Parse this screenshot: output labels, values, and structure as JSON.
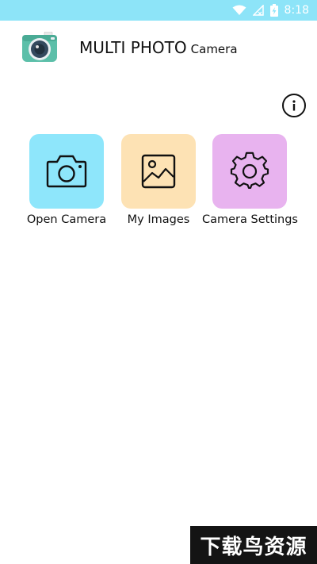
{
  "status_bar": {
    "time": "8:18",
    "background": "#8de4f8",
    "icons": [
      "wifi-icon",
      "no-signal-icon",
      "battery-charging-icon"
    ]
  },
  "header": {
    "title_main": "MULTI PHOTO",
    "title_sub": "Camera",
    "logo": "camera-logo-icon"
  },
  "info": {
    "icon": "info-icon"
  },
  "tiles": [
    {
      "label": "Open Camera",
      "icon": "camera-icon",
      "color": "#8ee6fb"
    },
    {
      "label": "My Images",
      "icon": "image-icon",
      "color": "#fde2b4"
    },
    {
      "label": "Camera Settings",
      "icon": "gear-icon",
      "color": "#e8b3ef"
    }
  ],
  "watermark": {
    "text": "下载鸟资源"
  }
}
